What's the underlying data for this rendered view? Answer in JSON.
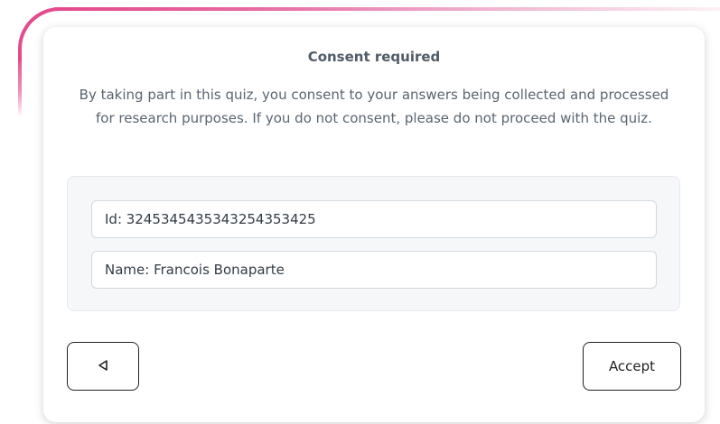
{
  "dialog": {
    "title": "Consent required",
    "message": "By taking part in this quiz, you consent to your answers being collected and processed for research purposes. If you do not consent, please do not proceed with the quiz."
  },
  "fields": {
    "id_value": "Id: 3245345435343254353425",
    "name_value": "Name: Francois Bonaparte"
  },
  "actions": {
    "back_icon": "triangle-left-icon",
    "accept_label": "Accept"
  },
  "colors": {
    "accent": "#e34b8c",
    "title_text": "#4f5b66",
    "panel_bg": "#f6f7f9"
  }
}
